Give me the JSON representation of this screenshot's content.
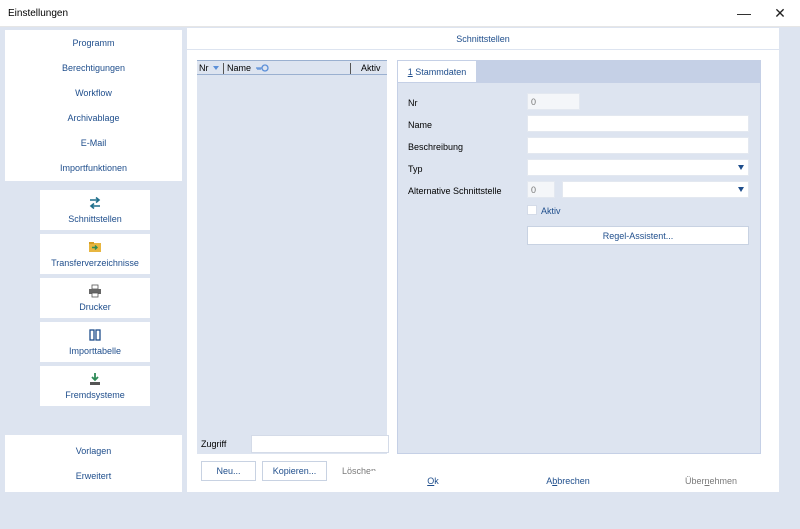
{
  "window": {
    "title": "Einstellungen",
    "minimize_glyph": "—",
    "close_glyph": "✕"
  },
  "nav": {
    "top_items": [
      {
        "label": "Programm"
      },
      {
        "label": "Berechtigungen"
      },
      {
        "label": "Workflow"
      },
      {
        "label": "Archivablage"
      },
      {
        "label": "E-Mail"
      },
      {
        "label": "Importfunktionen"
      }
    ],
    "tiles": [
      {
        "label": "Schnittstellen",
        "icon": "swap-arrows-icon"
      },
      {
        "label": "Transferverzeichnisse",
        "icon": "folder-transfer-icon"
      },
      {
        "label": "Drucker",
        "icon": "printer-icon"
      },
      {
        "label": "Importtabelle",
        "icon": "table-columns-icon"
      },
      {
        "label": "Fremdsysteme",
        "icon": "download-tray-icon"
      }
    ],
    "bottom_items": [
      {
        "label": "Vorlagen"
      },
      {
        "label": "Erweitert"
      }
    ]
  },
  "panel": {
    "title": "Schnittstellen",
    "list": {
      "columns": {
        "nr": "Nr",
        "name": "Name",
        "aktiv": "Aktiv"
      }
    },
    "zugriff_label": "Zugriff",
    "zugriff_value": "",
    "buttons": {
      "neu": "Neu...",
      "kopieren": "Kopieren...",
      "loeschen": "Löschen"
    },
    "tab": {
      "number": "1",
      "label": " Stammdaten"
    },
    "form": {
      "nr_label": "Nr",
      "nr_value": "0",
      "name_label": "Name",
      "name_value": "",
      "beschreibung_label": "Beschreibung",
      "beschreibung_value": "",
      "typ_label": "Typ",
      "typ_value": "",
      "alt_label": "Alternative Schnittstelle",
      "alt_nr_value": "0",
      "alt_value": "",
      "aktiv_label": "Aktiv",
      "aktiv_checked": false,
      "regel_button": "Regel-Assistent..."
    }
  },
  "dialog": {
    "ok": {
      "mnemonic": "O",
      "rest": "k"
    },
    "abbrechen": {
      "pre": "A",
      "mnemonic": "b",
      "rest": "brechen"
    },
    "uebernehmen": {
      "pre": "Über",
      "mnemonic": "n",
      "rest": "ehmen"
    }
  },
  "colors": {
    "accent": "#1f4e8c",
    "background": "#dde4f0",
    "tab_strip": "#c5d0e6"
  }
}
